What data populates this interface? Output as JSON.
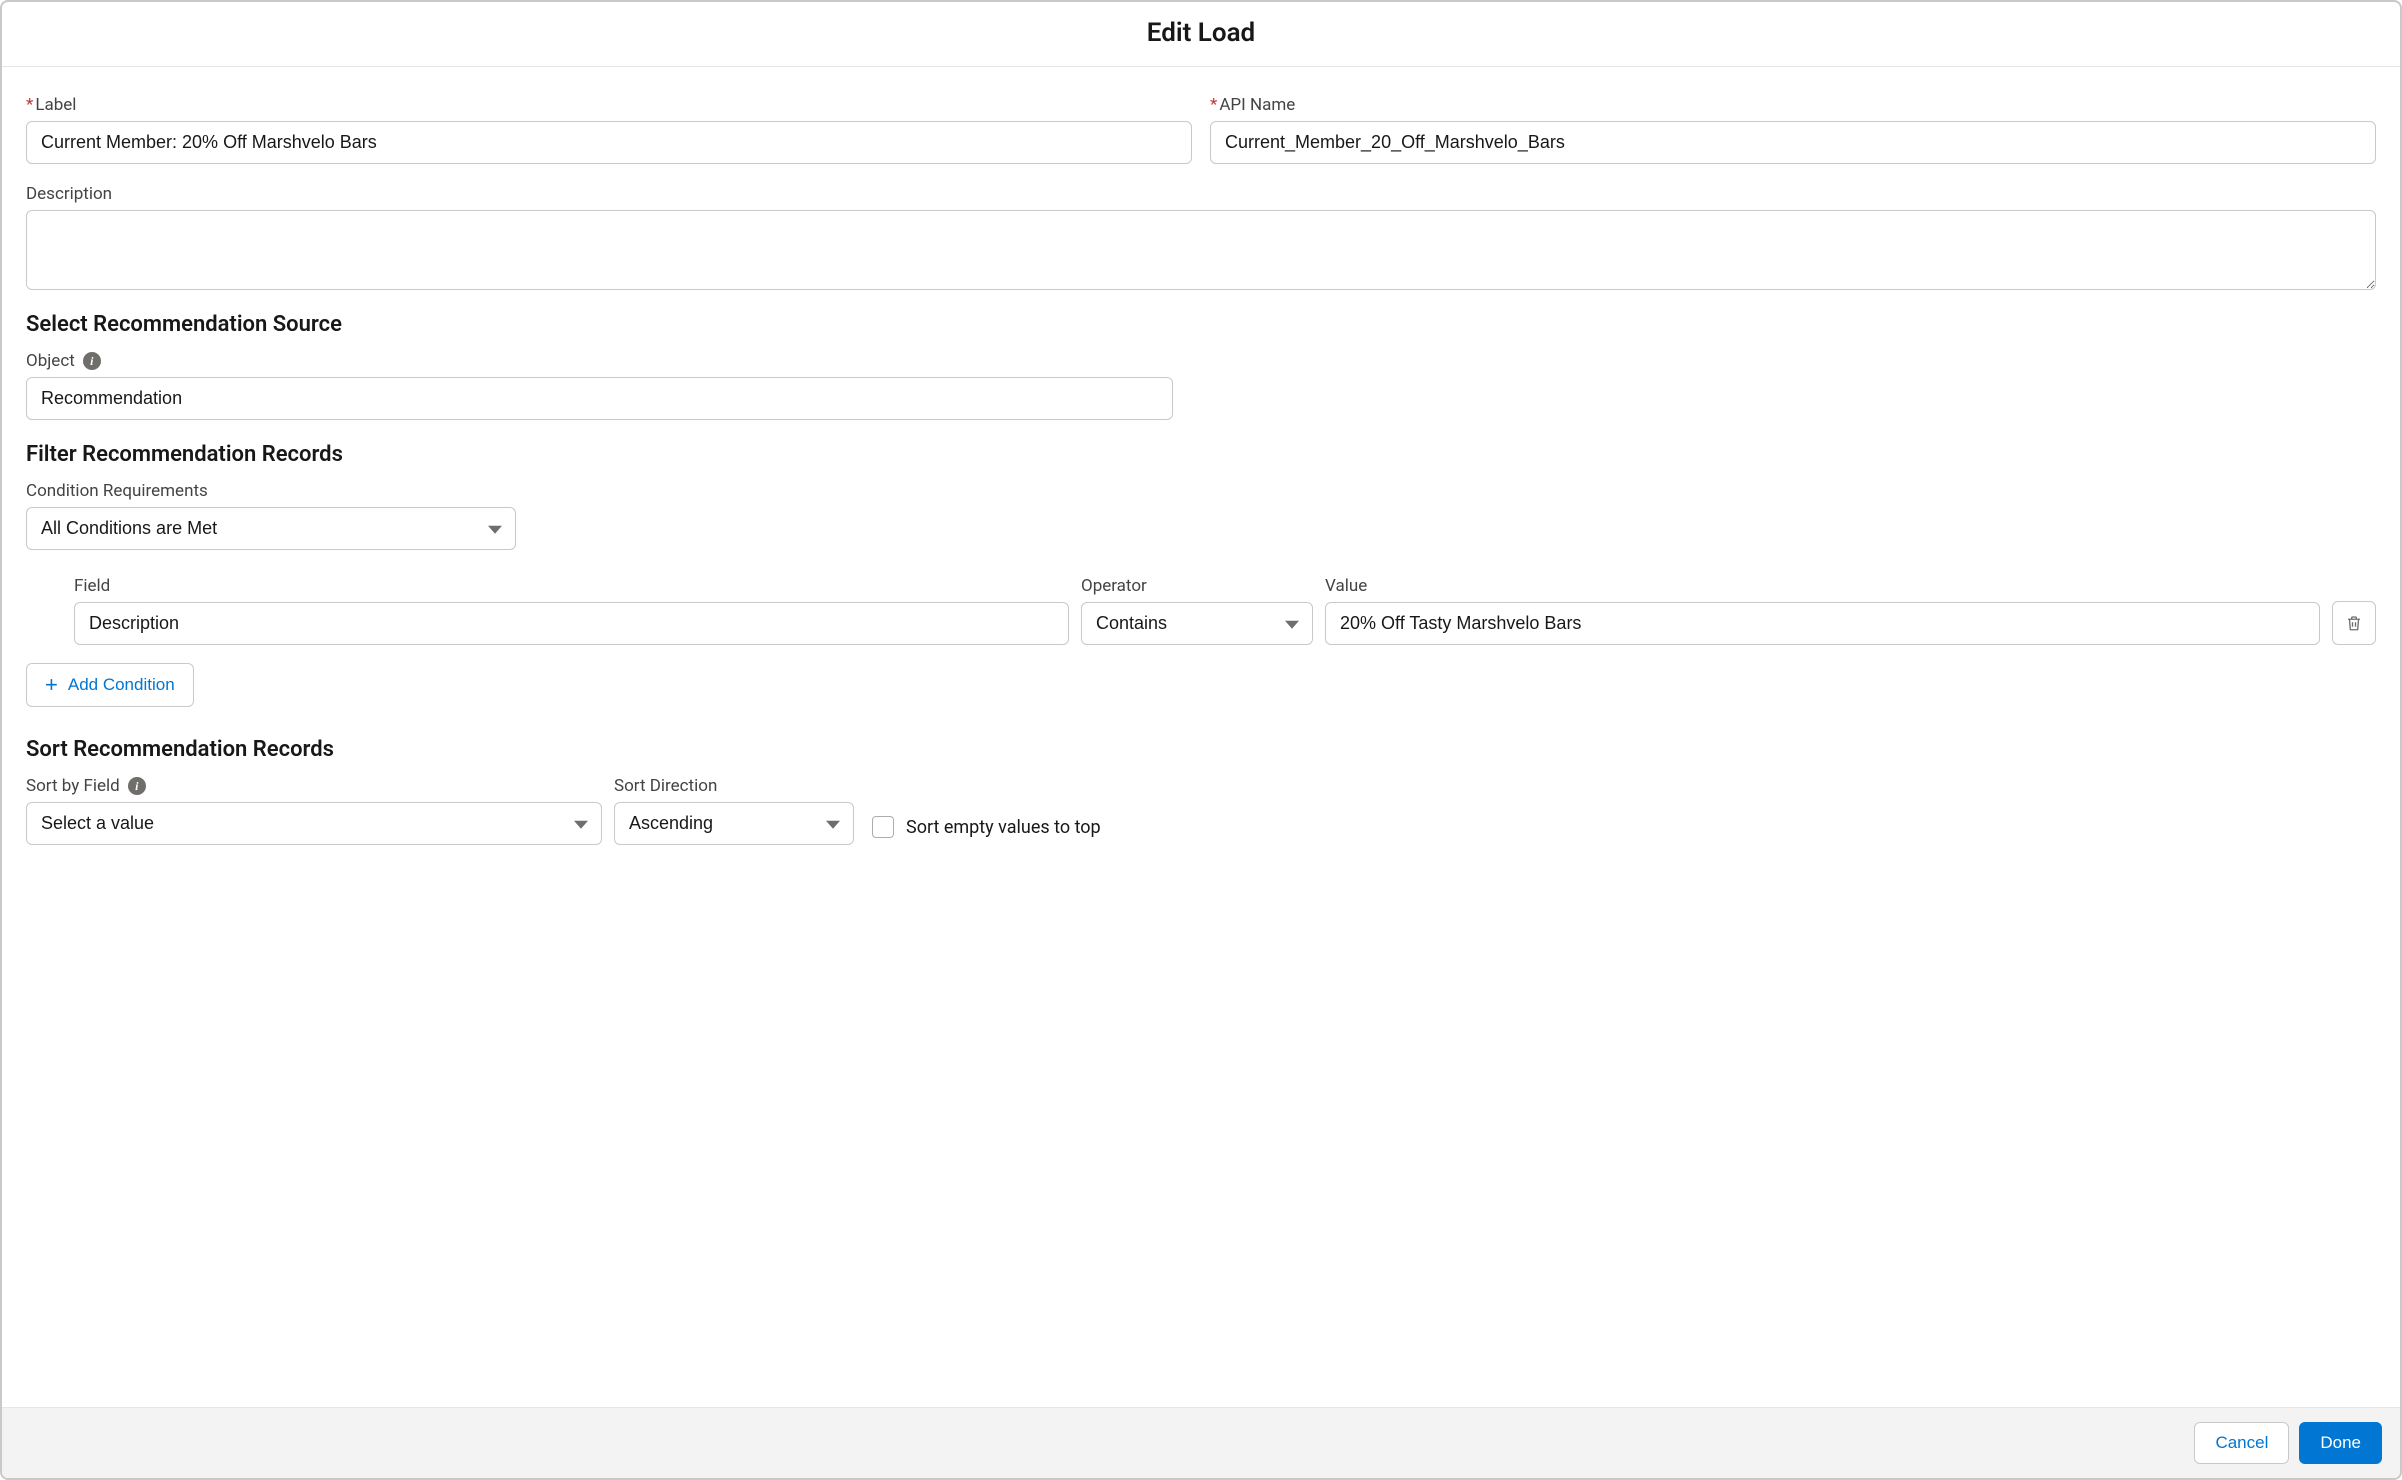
{
  "modal": {
    "title": "Edit Load"
  },
  "labels": {
    "label_field": "Label",
    "api_name": "API Name",
    "description": "Description",
    "section_source": "Select Recommendation Source",
    "object": "Object",
    "section_filter": "Filter Recommendation Records",
    "condition_requirements": "Condition Requirements",
    "field": "Field",
    "operator": "Operator",
    "value": "Value",
    "add_condition": "Add Condition",
    "section_sort": "Sort Recommendation Records",
    "sort_by_field": "Sort by Field",
    "sort_direction": "Sort Direction",
    "sort_empty_top": "Sort empty values to top"
  },
  "values": {
    "label": "Current Member: 20% Off Marshvelo Bars",
    "api_name": "Current_Member_20_Off_Marshvelo_Bars",
    "description": "",
    "object": "Recommendation",
    "condition_requirements": "All Conditions are Met",
    "condition_field": "Description",
    "condition_operator": "Contains",
    "condition_value": "20% Off Tasty Marshvelo Bars",
    "sort_by_field": "Select a value",
    "sort_direction": "Ascending"
  },
  "footer": {
    "cancel": "Cancel",
    "done": "Done"
  }
}
